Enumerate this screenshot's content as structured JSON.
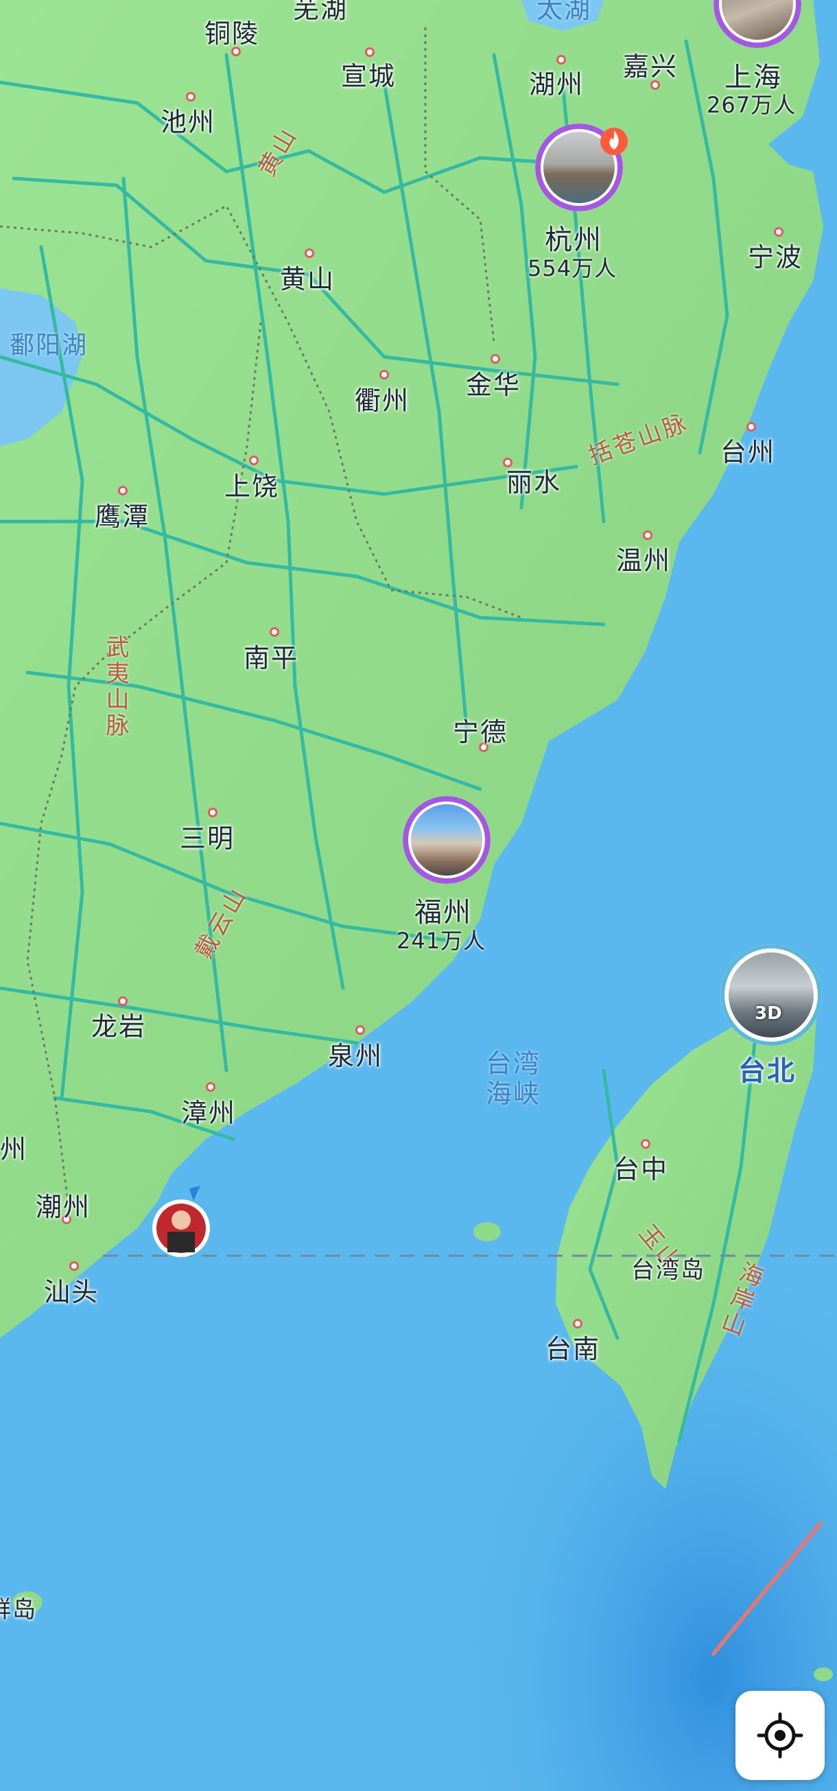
{
  "map": {
    "cities": [
      {
        "key": "tongling",
        "name": "铜陵"
      },
      {
        "key": "wuhu",
        "name": "芜湖"
      },
      {
        "key": "xuancheng",
        "name": "宣城"
      },
      {
        "key": "huzhou",
        "name": "湖州"
      },
      {
        "key": "jiaxing",
        "name": "嘉兴"
      },
      {
        "key": "chizhou",
        "name": "池州"
      },
      {
        "key": "huangshan",
        "name": "黄山"
      },
      {
        "key": "ningbo",
        "name": "宁波"
      },
      {
        "key": "quzhou",
        "name": "衢州"
      },
      {
        "key": "jinhua",
        "name": "金华"
      },
      {
        "key": "taizhou",
        "name": "台州"
      },
      {
        "key": "shangrao",
        "name": "上饶"
      },
      {
        "key": "lishui",
        "name": "丽水"
      },
      {
        "key": "yingtan",
        "name": "鹰潭"
      },
      {
        "key": "wenzhou",
        "name": "温州"
      },
      {
        "key": "nanping",
        "name": "南平"
      },
      {
        "key": "ningde",
        "name": "宁德"
      },
      {
        "key": "sanming",
        "name": "三明"
      },
      {
        "key": "longyan",
        "name": "龙岩"
      },
      {
        "key": "quanzhou",
        "name": "泉州"
      },
      {
        "key": "zhangzhou",
        "name": "漳州"
      },
      {
        "key": "chaozhou",
        "name": "潮州"
      },
      {
        "key": "shantou",
        "name": "汕头"
      },
      {
        "key": "taizhong",
        "name": "台中"
      },
      {
        "key": "tainan",
        "name": "台南"
      },
      {
        "key": "meizhou_partial",
        "name": "州"
      }
    ],
    "highlighted_cities": [
      {
        "key": "shanghai",
        "name": "上海",
        "population": "267万人"
      },
      {
        "key": "hangzhou",
        "name": "杭州",
        "population": "554万人"
      },
      {
        "key": "fuzhou",
        "name": "福州",
        "population": "241万人"
      },
      {
        "key": "taibei",
        "name": "台北",
        "badge": "3D"
      }
    ],
    "water_labels": {
      "taihu": "太湖",
      "poyang": "鄱阳湖",
      "strait": "台湾\n海峡"
    },
    "mountain_labels": {
      "huangshan_range": "黄山",
      "kuocang": "括苍山脉",
      "wuyi": "武夷山脉",
      "daiyun": "戴云山",
      "yushan": "玉山",
      "haian": "海岸山"
    },
    "island_labels": {
      "taiwan": "台湾岛",
      "partial_island": "群岛"
    },
    "colors": {
      "land": "#8fd98a",
      "sea": "#5bb8ee",
      "deep_sea": "#2f8fdd",
      "road": "#35b9a0",
      "province_border": "#6d7a5f",
      "ring": "#a457e0",
      "marker_dot": "#e25b5b"
    },
    "controls": {
      "locate_button": "locate-icon"
    }
  }
}
